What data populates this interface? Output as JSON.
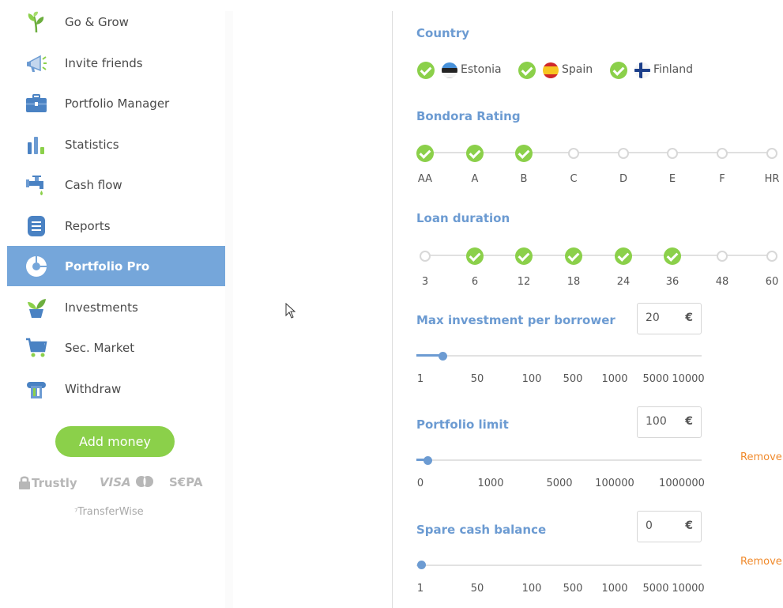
{
  "sidebar": {
    "items": [
      {
        "label": "Go & Grow",
        "icon": "sprout-icon"
      },
      {
        "label": "Invite friends",
        "icon": "megaphone-icon"
      },
      {
        "label": "Portfolio Manager",
        "icon": "briefcase-icon"
      },
      {
        "label": "Statistics",
        "icon": "bar-chart-icon"
      },
      {
        "label": "Cash flow",
        "icon": "faucet-icon"
      },
      {
        "label": "Reports",
        "icon": "document-icon"
      },
      {
        "label": "Portfolio Pro",
        "icon": "donut-chart-icon",
        "active": true
      },
      {
        "label": "Investments",
        "icon": "plant-pot-icon"
      },
      {
        "label": "Sec. Market",
        "icon": "cart-icon"
      },
      {
        "label": "Withdraw",
        "icon": "atm-icon"
      }
    ],
    "add_money_label": "Add money",
    "payment_logos": {
      "trustly": "Trustly",
      "visa": "VISA",
      "sepa": "S€PA",
      "transferwise": "TransferWise"
    }
  },
  "filters": {
    "country": {
      "title": "Country",
      "options": [
        {
          "label": "Estonia",
          "checked": true
        },
        {
          "label": "Spain",
          "checked": true
        },
        {
          "label": "Finland",
          "checked": true
        }
      ]
    },
    "rating": {
      "title": "Bondora Rating",
      "options": [
        {
          "label": "AA",
          "checked": true
        },
        {
          "label": "A",
          "checked": true
        },
        {
          "label": "B",
          "checked": true
        },
        {
          "label": "C",
          "checked": false
        },
        {
          "label": "D",
          "checked": false
        },
        {
          "label": "E",
          "checked": false
        },
        {
          "label": "F",
          "checked": false
        },
        {
          "label": "HR",
          "checked": false
        }
      ]
    },
    "duration": {
      "title": "Loan duration",
      "options": [
        {
          "label": "3",
          "checked": false
        },
        {
          "label": "6",
          "checked": true
        },
        {
          "label": "12",
          "checked": true
        },
        {
          "label": "18",
          "checked": true
        },
        {
          "label": "24",
          "checked": true
        },
        {
          "label": "36",
          "checked": true
        },
        {
          "label": "48",
          "checked": false
        },
        {
          "label": "60",
          "checked": false
        }
      ]
    },
    "max_investment": {
      "title": "Max investment per borrower",
      "value": "20",
      "currency": "€",
      "ticks": [
        "1",
        "50",
        "100",
        "500",
        "1000",
        "5000",
        "10000"
      ]
    },
    "portfolio_limit": {
      "title": "Portfolio limit",
      "value": "100",
      "currency": "€",
      "ticks": [
        "0",
        "1000",
        "5000",
        "100000",
        "1000000"
      ],
      "remove_label": "Remove"
    },
    "spare_cash": {
      "title": "Spare cash balance",
      "value": "0",
      "currency": "€",
      "ticks": [
        "1",
        "50",
        "100",
        "500",
        "1000",
        "5000",
        "10000"
      ],
      "remove_label": "Remove"
    }
  },
  "colors": {
    "accent_blue": "#6c9bd2",
    "active_bg": "#75a6da",
    "check_green": "#8bd04a",
    "remove_orange": "#f08a2c"
  }
}
